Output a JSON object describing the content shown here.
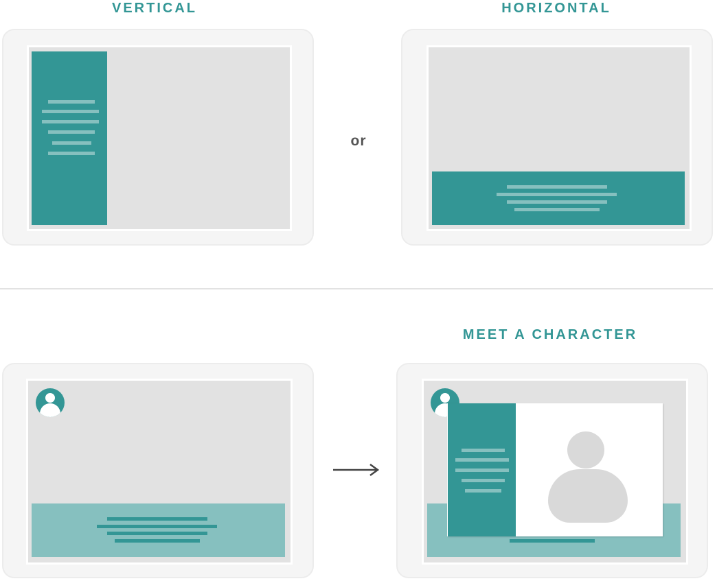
{
  "labels": {
    "vertical": "VERTICAL",
    "horizontal": "HORIZONTAL",
    "or": "or",
    "meet_character": "MEET A CHARACTER"
  },
  "colors": {
    "teal": "#339695",
    "teal_light": "#86c0bf",
    "screen_gray": "#e2e2e2",
    "tablet_gray": "#f5f5f5",
    "text_dark": "#555555"
  },
  "icons": [
    "avatar-icon",
    "arrow-right-icon",
    "character-silhouette-icon"
  ]
}
